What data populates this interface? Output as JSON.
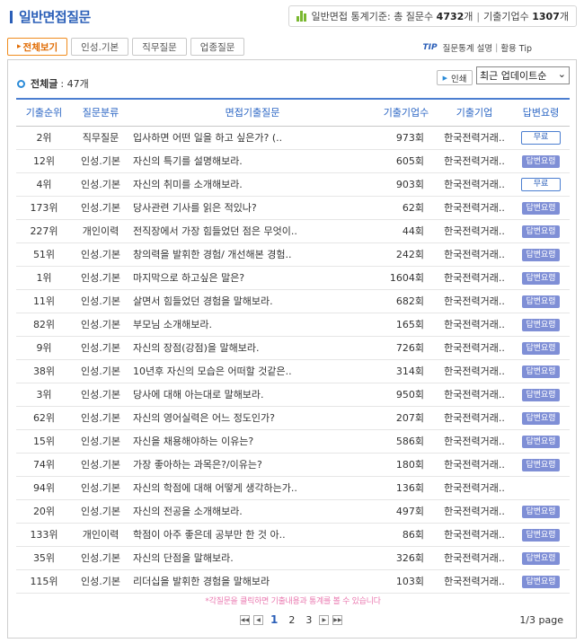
{
  "header": {
    "title": "일반면접질문",
    "stats_prefix": "일반면접 통계기준: 총 질문수",
    "stats_questions": "4732",
    "stats_unit1": "개",
    "stats_sep": "|",
    "stats_company_label": "기출기업수",
    "stats_companies": "1307",
    "stats_unit2": "개"
  },
  "tabs": [
    {
      "label": "전체보기",
      "active": true
    },
    {
      "label": "인성.기본",
      "active": false
    },
    {
      "label": "직무질문",
      "active": false
    },
    {
      "label": "업종질문",
      "active": false
    }
  ],
  "tip": {
    "label": "TIP",
    "text1": "질문통계 설명",
    "sep": "|",
    "text2": "활용 Tip"
  },
  "summary": {
    "label": "전체글",
    "count": ": 47개"
  },
  "controls": {
    "print_label": "인쇄",
    "sort_selected": "최근 업데이트순"
  },
  "table": {
    "headers": [
      "기출순위",
      "질문분류",
      "면접기출질문",
      "기출기업수",
      "기출기업",
      "답변요령"
    ],
    "rows": [
      {
        "rank": "2위",
        "category": "직무질문",
        "question": "입사하면 어떤 일을 하고 싶은가? (..",
        "count": "973회",
        "company": "한국전력거래..",
        "answer": "무료",
        "answer_type": "free"
      },
      {
        "rank": "12위",
        "category": "인성.기본",
        "question": "자신의 특기를 설명해보라.",
        "count": "605회",
        "company": "한국전력거래..",
        "answer": "답변요령",
        "answer_type": "paid"
      },
      {
        "rank": "4위",
        "category": "인성.기본",
        "question": "자신의 취미를 소개해보라.",
        "count": "903회",
        "company": "한국전력거래..",
        "answer": "무료",
        "answer_type": "free"
      },
      {
        "rank": "173위",
        "category": "인성.기본",
        "question": "당사관련 기사를 읽은 적있나?",
        "count": "62회",
        "company": "한국전력거래..",
        "answer": "답변요령",
        "answer_type": "paid"
      },
      {
        "rank": "227위",
        "category": "개인이력",
        "question": "전직장에서 가장 힘들었던 점은 무엇이..",
        "count": "44회",
        "company": "한국전력거래..",
        "answer": "답변요령",
        "answer_type": "paid"
      },
      {
        "rank": "51위",
        "category": "인성.기본",
        "question": "창의력을 발휘한 경험/ 개선해본 경험..",
        "count": "242회",
        "company": "한국전력거래..",
        "answer": "답변요령",
        "answer_type": "paid"
      },
      {
        "rank": "1위",
        "category": "인성.기본",
        "question": "마지막으로 하고싶은 말은?",
        "count": "1604회",
        "company": "한국전력거래..",
        "answer": "답변요령",
        "answer_type": "paid"
      },
      {
        "rank": "11위",
        "category": "인성.기본",
        "question": "살면서 힘들었던 경험을 말해보라.",
        "count": "682회",
        "company": "한국전력거래..",
        "answer": "답변요령",
        "answer_type": "paid"
      },
      {
        "rank": "82위",
        "category": "인성.기본",
        "question": "부모님 소개해보라.",
        "count": "165회",
        "company": "한국전력거래..",
        "answer": "답변요령",
        "answer_type": "paid"
      },
      {
        "rank": "9위",
        "category": "인성.기본",
        "question": "자신의 장점(강점)을 말해보라.",
        "count": "726회",
        "company": "한국전력거래..",
        "answer": "답변요령",
        "answer_type": "paid"
      },
      {
        "rank": "38위",
        "category": "인성.기본",
        "question": "10년후 자신의 모습은 어떠할 것같은..",
        "count": "314회",
        "company": "한국전력거래..",
        "answer": "답변요령",
        "answer_type": "paid"
      },
      {
        "rank": "3위",
        "category": "인성.기본",
        "question": "당사에 대해 아는대로 말해보라.",
        "count": "950회",
        "company": "한국전력거래..",
        "answer": "답변요령",
        "answer_type": "paid"
      },
      {
        "rank": "62위",
        "category": "인성.기본",
        "question": "자신의 영어실력은 어느 정도인가?",
        "count": "207회",
        "company": "한국전력거래..",
        "answer": "답변요령",
        "answer_type": "paid"
      },
      {
        "rank": "15위",
        "category": "인성.기본",
        "question": "자신을 채용해야하는 이유는?",
        "count": "586회",
        "company": "한국전력거래..",
        "answer": "답변요령",
        "answer_type": "paid"
      },
      {
        "rank": "74위",
        "category": "인성.기본",
        "question": "가장 좋아하는 과목은?/이유는?",
        "count": "180회",
        "company": "한국전력거래..",
        "answer": "답변요령",
        "answer_type": "paid"
      },
      {
        "rank": "94위",
        "category": "인성.기본",
        "question": "자신의 학점에 대해 어떻게 생각하는가..",
        "count": "136회",
        "company": "한국전력거래..",
        "answer": "",
        "answer_type": "none"
      },
      {
        "rank": "20위",
        "category": "인성.기본",
        "question": "자신의 전공을 소개해보라.",
        "count": "497회",
        "company": "한국전력거래..",
        "answer": "답변요령",
        "answer_type": "paid"
      },
      {
        "rank": "133위",
        "category": "개인이력",
        "question": "학점이 아주 좋은데 공부만 한 것 아..",
        "count": "86회",
        "company": "한국전력거래..",
        "answer": "답변요령",
        "answer_type": "paid"
      },
      {
        "rank": "35위",
        "category": "인성.기본",
        "question": "자신의 단점을 말해보라.",
        "count": "326회",
        "company": "한국전력거래..",
        "answer": "답변요령",
        "answer_type": "paid"
      },
      {
        "rank": "115위",
        "category": "인성.기본",
        "question": "리더십을 발휘한 경험을 말해보라",
        "count": "103회",
        "company": "한국전력거래..",
        "answer": "답변요령",
        "answer_type": "paid"
      }
    ]
  },
  "footer": {
    "note": "*각질문을 클릭하면 기출내용과 통계를 볼 수 있습니다",
    "pages": [
      "1",
      "2",
      "3"
    ],
    "current_page": "1",
    "page_info": "1/3 page"
  },
  "colors": {
    "brand_blue": "#2b5fb8",
    "active_tab_orange": "#f08c1e",
    "answer_button": "#7f8fd6",
    "note_pink": "#ea7ab0"
  }
}
